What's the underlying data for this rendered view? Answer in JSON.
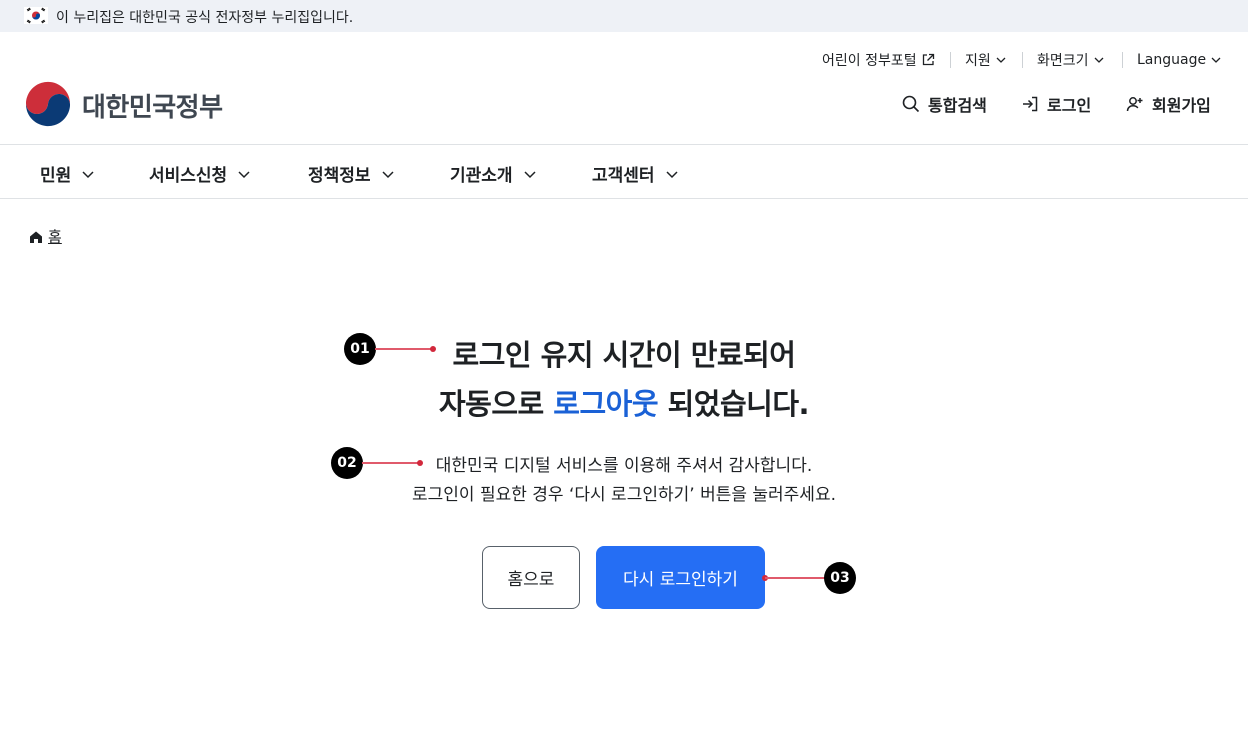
{
  "banner": {
    "text": "이 누리집은 대한민국 공식 전자정부 누리집입니다."
  },
  "utility": {
    "kids_portal": "어린이 정부포털",
    "support": "지원",
    "screen_size": "화면크기",
    "language": "Language"
  },
  "logo": {
    "text": "대한민국정부"
  },
  "actions": {
    "search": "통합검색",
    "login": "로그인",
    "signup": "회원가입"
  },
  "gnb": [
    "민원",
    "서비스신청",
    "정책정보",
    "기관소개",
    "고객센터"
  ],
  "breadcrumb": {
    "home": "홈"
  },
  "main": {
    "title_line1": "로그인 유지 시간이 만료되어",
    "title_line2_pre": "자동으로 ",
    "title_line2_highlight": "로그아웃",
    "title_line2_post": " 되었습니다.",
    "desc_line1": "대한민국 디지털 서비스를 이용해 주셔서 감사합니다.",
    "desc_line2": "로그인이 필요한 경우 ‘다시 로그인하기’ 버튼을 눌러주세요.",
    "home_button": "홈으로",
    "relogin_button": "다시 로그인하기"
  },
  "markers": [
    "01",
    "02",
    "03"
  ],
  "colors": {
    "accent": "#256ef4",
    "highlight": "#1a61d6",
    "banner_bg": "#eef1f6",
    "marker_line": "#e05a6b"
  }
}
